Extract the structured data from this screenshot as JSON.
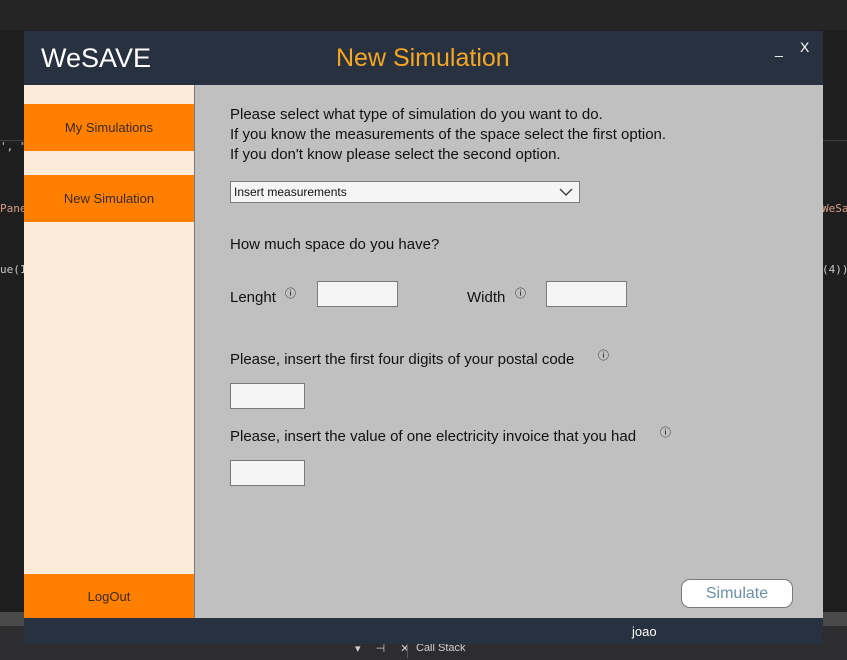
{
  "ide": {
    "fragments": {
      "quote": "', \"",
      "pane": "Pane",
      "wesa": "WeSa",
      "ue": "ue(1",
      "four": "(4))"
    },
    "callstack_label": "Call Stack",
    "controls": "▾ ⊣ ✕"
  },
  "app": {
    "brand": "WeSAVE",
    "title": "New Simulation",
    "minimize": "_",
    "close": "X"
  },
  "sidebar": {
    "my_simulations": "My Simulations",
    "new_simulation": "New Simulation",
    "logout": "LogOut"
  },
  "form": {
    "intro": [
      "Please select what type of simulation do you want to do.",
      "If you know the measurements of the space select the first option.",
      "If you don't know please select the second option."
    ],
    "simulation_type": "Insert measurements",
    "space_question": "How much space do you have?",
    "length_label": "Lenght",
    "width_label": "Width",
    "length_value": "",
    "width_value": "",
    "postal_label": "Please, insert the first four digits of your postal code",
    "postal_value": "",
    "invoice_label": "Please, insert the value of one electricity invoice that you had",
    "invoice_value": "",
    "info_glyph": "ⓘ",
    "simulate_label": "Simulate"
  },
  "status": {
    "username": "joao"
  },
  "colors": {
    "accent": "#ff8000",
    "title_orange": "#f5a623",
    "titlebar": "#27313f",
    "sidebar_bg": "#fbebd8",
    "main_bg": "#c0c0c0"
  }
}
